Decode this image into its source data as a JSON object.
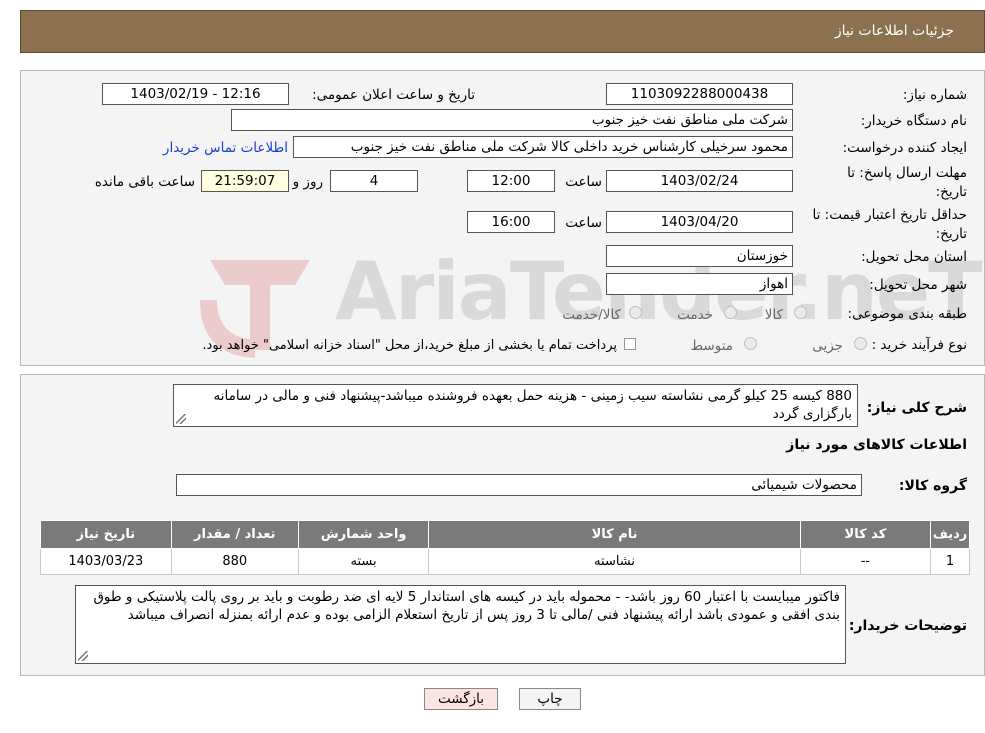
{
  "header": {
    "title": "جزئیات اطلاعات نیاز"
  },
  "form": {
    "need_number_label": "شماره نیاز:",
    "need_number": "1103092288000438",
    "announce_label": "تاریخ و ساعت اعلان عمومی:",
    "announce_value": "1403/02/19 - 12:16",
    "buyer_org_label": "نام دستگاه خریدار:",
    "buyer_org": "شرکت ملی مناطق نفت خیز جنوب",
    "creator_label": "ایجاد کننده درخواست:",
    "creator": "محمود سرخیلی کارشناس خرید داخلی کالا شرکت ملی مناطق نفت خیز جنوب",
    "contact_link": "اطلاعات تماس خریدار",
    "reply_deadline_label": "مهلت ارسال پاسخ: تا تاریخ:",
    "reply_date": "1403/02/24",
    "time_label": "ساعت",
    "reply_time": "12:00",
    "days_value": "4",
    "days_label": "روز و",
    "remaining_time": "21:59:07",
    "remaining_label": "ساعت باقی مانده",
    "price_validity_label": "حداقل تاریخ اعتبار قیمت: تا تاریخ:",
    "price_date": "1403/04/20",
    "price_time": "16:00",
    "province_label": "استان محل تحویل:",
    "province": "خوزستان",
    "city_label": "شهر محل تحویل:",
    "city": "اهواز",
    "category_label": "طبقه بندی موضوعی:",
    "category_options": [
      "کالا",
      "خدمت",
      "کالا/خدمت"
    ],
    "process_label": "نوع فرآیند خرید :",
    "process_options": [
      "جزیی",
      "متوسط"
    ],
    "payment_note": "پرداخت تمام یا بخشی از مبلغ خرید،از محل \"اسناد خزانه اسلامی\" خواهد بود."
  },
  "details": {
    "description_label": "شرح کلی نیاز:",
    "description": "880 کیسه 25 کیلو گرمی نشاسته سیب زمینی - هزینه حمل بعهده فروشنده میباشد-پیشنهاد فنی و مالی در سامانه بارگزاری گردد",
    "goods_info_title": "اطلاعات کالاهای مورد نیاز",
    "goods_group_label": "گروه کالا:",
    "goods_group": "محصولات شیمیائی",
    "table": {
      "headers": [
        "ردیف",
        "کد کالا",
        "نام کالا",
        "واحد شمارش",
        "تعداد / مقدار",
        "تاریخ نیاز"
      ],
      "rows": [
        [
          "1",
          "--",
          "نشاسته",
          "بسته",
          "880",
          "1403/03/23"
        ]
      ]
    },
    "buyer_notes_label": "توضیحات خریدار:",
    "buyer_notes": "فاکتور میبایست با اعتبار 60 روز باشد- - محموله باید در کیسه های استاندار 5 لایه ای ضد رطوبت و باید بر روی پالت پلاستیکی و طوق بندی افقی و عمودی باشد ارائه پیشنهاد فنی /مالی تا 3 روز پس از تاریخ استعلام الزامی بوده و عدم ارائه بمنزله انصراف میباشد"
  },
  "buttons": {
    "print": "چاپ",
    "back": "بازگشت"
  },
  "watermark": {
    "text": "AriaTender.neT"
  },
  "colors": {
    "header_bg": "#8b7150",
    "table_header": "#7a7a7a",
    "link": "#1a3fd0",
    "back_btn_bg": "#fde4e4"
  }
}
